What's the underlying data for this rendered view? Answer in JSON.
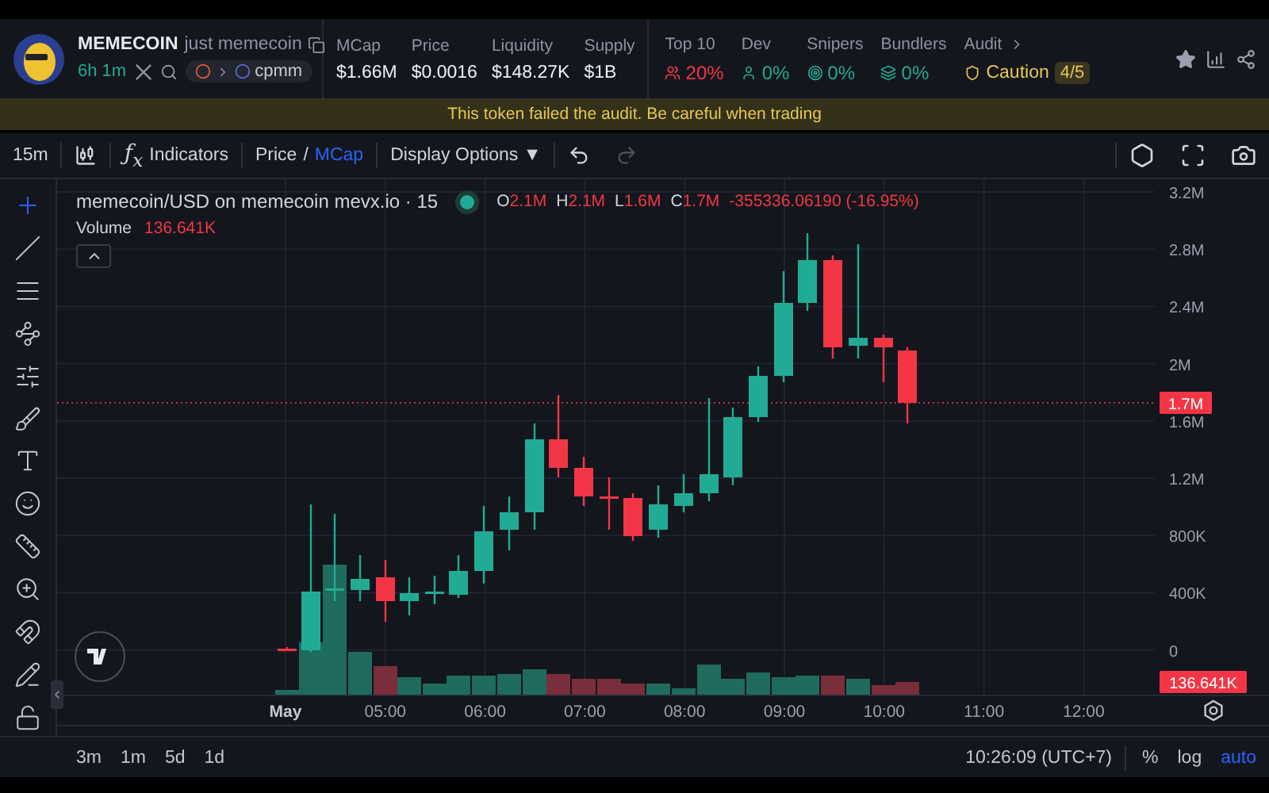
{
  "token": {
    "symbol": "MEMECOIN",
    "name": "just memecoin",
    "age": "6h 1m",
    "pair_tag": "cpmm"
  },
  "metrics": [
    {
      "label": "MCap",
      "value": "$1.66M"
    },
    {
      "label": "Price",
      "value": "$0.0016"
    },
    {
      "label": "Liquidity",
      "value": "$148.27K"
    },
    {
      "label": "Supply",
      "value": "$1B"
    }
  ],
  "audit_stats": [
    {
      "label": "Top 10",
      "value": "20%",
      "kind": "holders",
      "color": "#f23645"
    },
    {
      "label": "Dev",
      "value": "0%",
      "kind": "dev",
      "color": "#22ab94"
    },
    {
      "label": "Snipers",
      "value": "0%",
      "kind": "snipers",
      "color": "#22ab94"
    },
    {
      "label": "Bundlers",
      "value": "0%",
      "kind": "bundlers",
      "color": "#22ab94"
    }
  ],
  "audit": {
    "label": "Audit",
    "status": "Caution",
    "score": "4/5"
  },
  "warning": "This token failed the audit. Be careful when trading",
  "toolbar": {
    "interval": "15m",
    "indicators_symbol": "ƒ$_{x}$",
    "indicators": "Indicators",
    "price_modes": [
      {
        "label": "Price",
        "selected": false
      },
      {
        "label": "MCap",
        "selected": true
      }
    ],
    "separator": "/",
    "display_options": "Display Options",
    "caret": "▼",
    "redo_disabled": true
  },
  "tools": [
    {
      "kind": "crosshair",
      "selected": true
    },
    {
      "kind": "trend-line",
      "selected": false
    },
    {
      "kind": "lines",
      "selected": false
    },
    {
      "kind": "pattern",
      "selected": false
    },
    {
      "kind": "fib",
      "selected": false
    },
    {
      "kind": "brush",
      "selected": false
    },
    {
      "kind": "text",
      "selected": false
    },
    {
      "kind": "emoji",
      "selected": false
    },
    {
      "kind": "ruler",
      "selected": false
    },
    {
      "kind": "zoom",
      "selected": false
    },
    {
      "kind": "magnet",
      "selected": false
    },
    {
      "kind": "lock-drawing",
      "selected": false
    },
    {
      "kind": "lock",
      "selected": false
    }
  ],
  "legend": {
    "title": "memecoin/USD on memecoin mevx.io · 15",
    "ohlc": [
      {
        "label": "O",
        "value": "2.1M"
      },
      {
        "label": "H",
        "value": "2.1M"
      },
      {
        "label": "L",
        "value": "1.6M"
      },
      {
        "label": "C",
        "value": "1.7M"
      }
    ],
    "change": "-355336.06190 (-16.95%)",
    "volume_label": "Volume",
    "volume_value": "136.641K"
  },
  "price_axis": [
    "3.2M",
    "2.8M",
    "2.4M",
    "2M",
    "1.6M",
    "1.2M",
    "800K",
    "400K",
    "0"
  ],
  "time_axis": [
    "May",
    "05:00",
    "06:00",
    "07:00",
    "08:00",
    "09:00",
    "10:00",
    "11:00",
    "12:00"
  ],
  "last_price": "1.7M",
  "last_volume": "136.641K",
  "ranges": [
    "3m",
    "1m",
    "5d",
    "1d"
  ],
  "clock": "10:26:09 (UTC+7)",
  "scale_options": [
    {
      "label": "%",
      "selected": false
    },
    {
      "label": "log",
      "selected": false
    },
    {
      "label": "auto",
      "selected": true
    }
  ]
}
